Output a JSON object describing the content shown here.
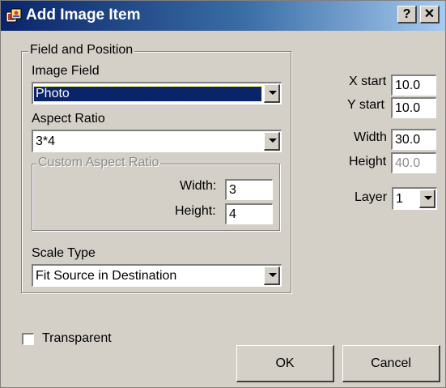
{
  "window": {
    "title": "Add Image Item",
    "help_label": "?",
    "close_label": "✕"
  },
  "field_position": {
    "legend": "Field and Position",
    "image_field_label": "Image Field",
    "image_field_value": "Photo",
    "aspect_ratio_label": "Aspect Ratio",
    "aspect_ratio_value": "3*4",
    "custom": {
      "legend": "Custom Aspect Ratio",
      "width_label": "Width:",
      "width_value": "3",
      "height_label": "Height:",
      "height_value": "4"
    },
    "scale_type_label": "Scale Type",
    "scale_type_value": "Fit Source in Destination"
  },
  "position": {
    "x_start_label": "X start",
    "x_start_value": "10.0",
    "y_start_label": "Y start",
    "y_start_value": "10.0",
    "width_label": "Width",
    "width_value": "30.0",
    "height_label": "Height",
    "height_value": "40.0",
    "layer_label": "Layer",
    "layer_value": "1"
  },
  "transparent_label": "Transparent",
  "transparent_checked": false,
  "buttons": {
    "ok": "OK",
    "cancel": "Cancel"
  },
  "colors": {
    "title_bar": "#0a246a",
    "face": "#d4d0c8",
    "selection": "#0a246a"
  },
  "icons": [
    "app-icon",
    "help-icon",
    "close-icon",
    "chevron-down-icon"
  ]
}
